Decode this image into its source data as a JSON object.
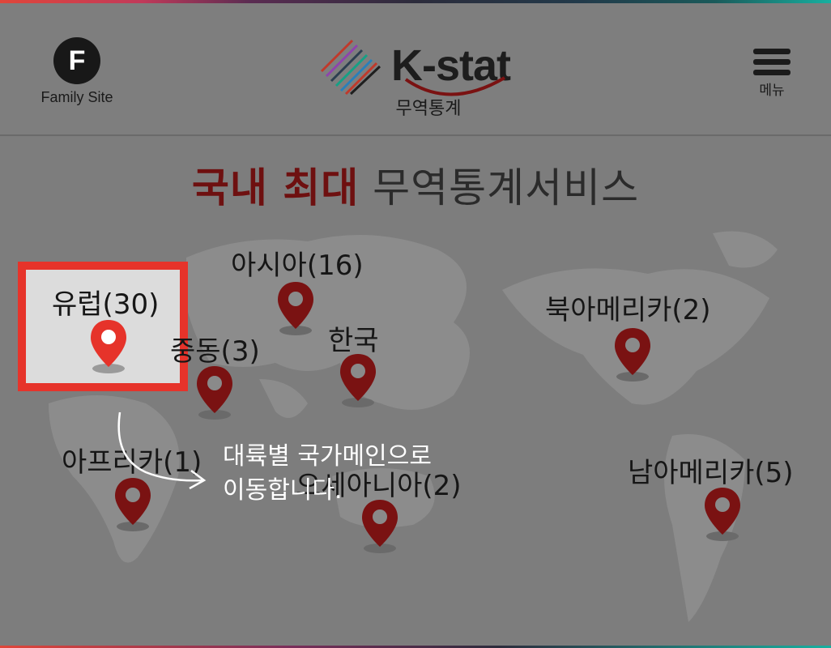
{
  "header": {
    "family_site": {
      "letter": "F",
      "label": "Family Site"
    },
    "logo": {
      "text": "K-stat",
      "subtitle": "무역통계"
    },
    "menu": {
      "label": "메뉴"
    }
  },
  "title": {
    "highlight": "국내 최대",
    "rest": "무역통계서비스"
  },
  "regions": {
    "europe": "유럽(30)",
    "asia": "아시아(16)",
    "middle_east": "중동(3)",
    "korea": "한국",
    "north_america": "북아메리카(2)",
    "africa": "아프리카(1)",
    "oceania": "오세아니아(2)",
    "south_america": "남아메리카(5)"
  },
  "hint": {
    "line1": "대륙별 국가메인으로",
    "line2": "이동합니다."
  },
  "colors": {
    "pin": "#7a1212",
    "pin_active": "#e6332a",
    "highlight_border": "#e6332a",
    "title_accent": "#6e1010"
  }
}
